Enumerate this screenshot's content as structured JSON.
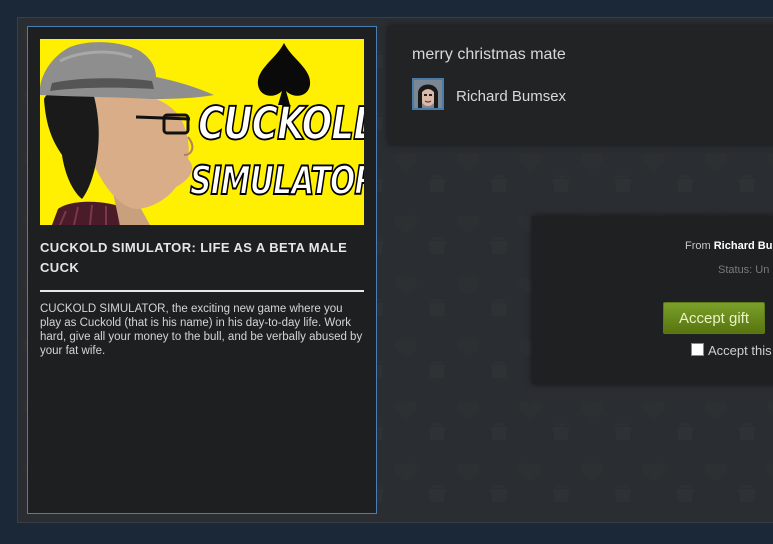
{
  "game": {
    "capsule_line1": "CUCKOLD",
    "capsule_line2": "SIMULATOR",
    "title": "CUCKOLD SIMULATOR: LIFE AS A BETA MALE CUCK",
    "description": "CUCKOLD SIMULATOR, the exciting new game where you play as Cuckold (that is his name) in his day-to-day life. Work hard, give all your money to the bull, and be verbally abused by your fat wife."
  },
  "message": {
    "text": "merry christmas mate",
    "sender": "Richard Bumsex"
  },
  "accept": {
    "from_label": "From",
    "from_name": "Richard Bu",
    "status": "Status: Un",
    "button_label": "Accept gift",
    "checkbox_label": "Accept this"
  },
  "colors": {
    "background": "#1b2838",
    "card_border": "#4a7fb3",
    "capsule_yellow": "#ffef00",
    "accept_green": "#6a8c1f"
  }
}
